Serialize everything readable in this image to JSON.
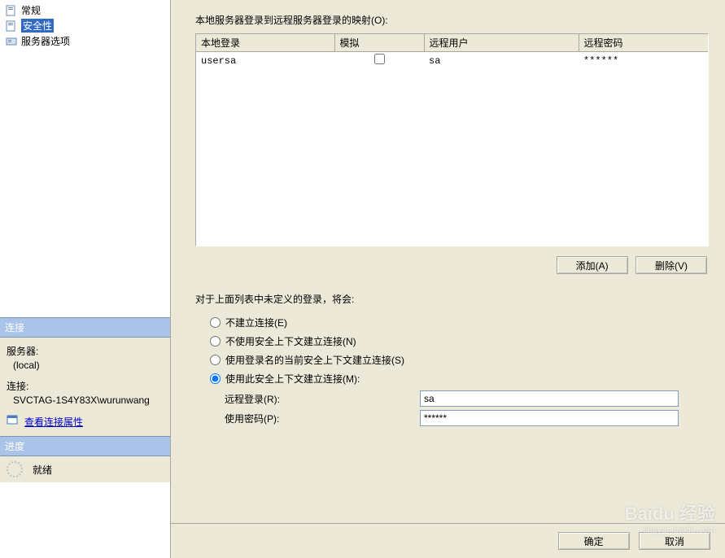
{
  "sidebar": {
    "tree": [
      {
        "label": "常规",
        "icon": "page"
      },
      {
        "label": "安全性",
        "icon": "page",
        "selected": true
      },
      {
        "label": "服务器选项",
        "icon": "server"
      }
    ],
    "conn_header": "连接",
    "server_label": "服务器:",
    "server_value": "(local)",
    "connection_label": "连接:",
    "connection_value": "SVCTAG-1S4Y83X\\wurunwang",
    "view_props": "查看连接属性",
    "progress_header": "进度",
    "progress_status": "就绪"
  },
  "main": {
    "intro": "本地服务器登录到远程服务器登录的映射(O):",
    "columns": {
      "local": "本地登录",
      "impersonate": "模拟",
      "remote_user": "远程用户",
      "remote_pwd": "远程密码"
    },
    "rows": [
      {
        "local": "usersa",
        "impersonate": false,
        "remote_user": "sa",
        "remote_pwd": "******"
      }
    ],
    "add_btn": "添加(A)",
    "delete_btn": "删除(V)",
    "undefined_label": "对于上面列表中未定义的登录，将会:",
    "radios": {
      "r1": "不建立连接(E)",
      "r2": "不使用安全上下文建立连接(N)",
      "r3": "使用登录名的当前安全上下文建立连接(S)",
      "r4": "使用此安全上下文建立连接(M):"
    },
    "remote_login_label": "远程登录(R):",
    "remote_login_value": "sa",
    "use_pwd_label": "使用密码(P):",
    "use_pwd_value": "******",
    "ok": "确定",
    "cancel": "取消"
  },
  "watermark": {
    "brand": "Baidu 经验",
    "url": "jingyan.baidu.com"
  }
}
